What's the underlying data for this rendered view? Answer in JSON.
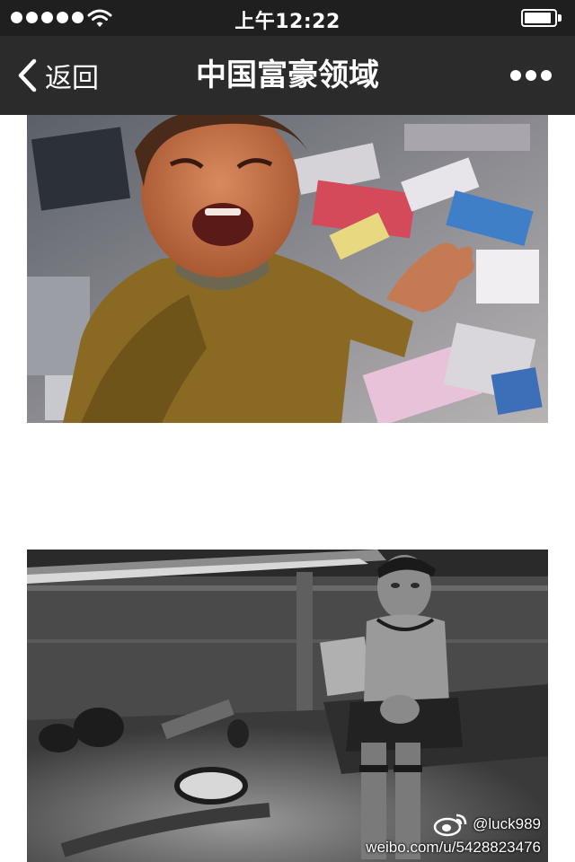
{
  "status_bar": {
    "time": "上午12:22",
    "icons": [
      "signal-dots-icon",
      "wifi-icon",
      "battery-icon"
    ],
    "battery_level": 0.9
  },
  "nav": {
    "back_label": "返回",
    "title": "中国富豪领域",
    "more_icon": "more-dots-icon"
  },
  "photos": [
    {
      "subject": "crying child in a garbage dump"
    },
    {
      "subject": "woman sitting in a dark hut, black-and-white"
    }
  ],
  "watermark": {
    "handle": "@luck989",
    "url": "weibo.com/u/5428823476",
    "icon": "weibo-icon"
  },
  "colors": {
    "status_bar": "#1f1f1f",
    "nav_bar": "#2b2b2b",
    "text_light": "#ffffff",
    "page_background": "#ffffff"
  }
}
